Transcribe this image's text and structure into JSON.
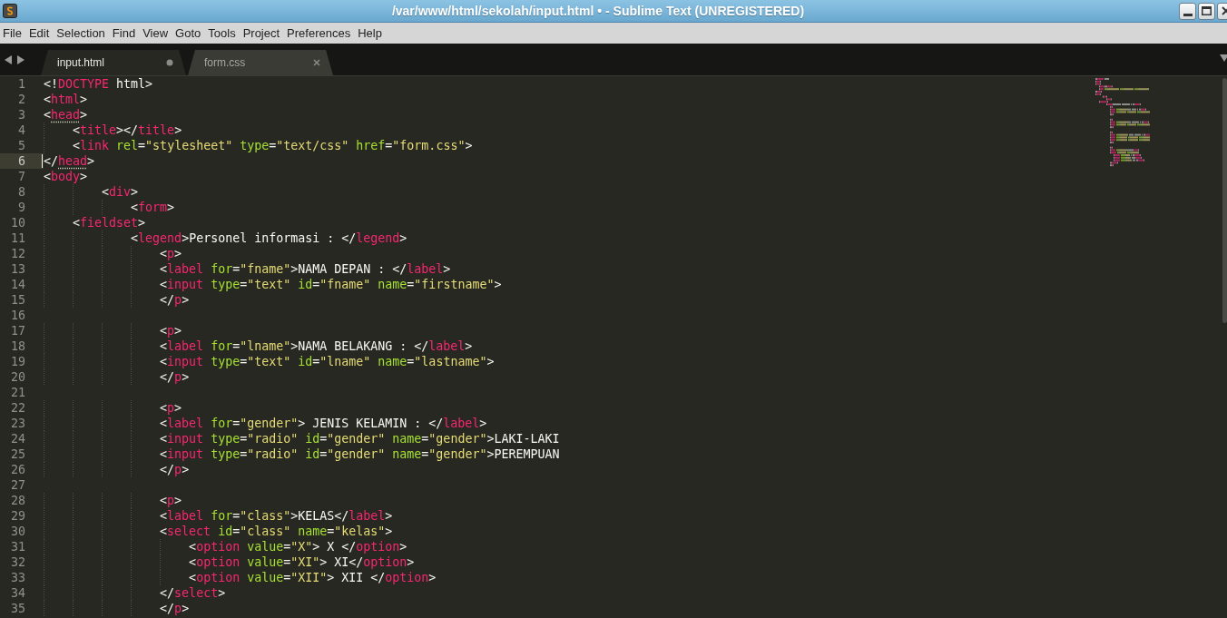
{
  "window": {
    "title": "/var/www/html/sekolah/input.html • - Sublime Text (UNREGISTERED)"
  },
  "menu": [
    "File",
    "Edit",
    "Selection",
    "Find",
    "View",
    "Goto",
    "Tools",
    "Project",
    "Preferences",
    "Help"
  ],
  "tabs": [
    {
      "label": "input.html",
      "selected": true,
      "modified": true
    },
    {
      "label": "form.css",
      "selected": false,
      "modified": false
    }
  ],
  "editor": {
    "lines": [
      {
        "n": "1",
        "current": false,
        "tokens": [
          {
            "kind": "plain",
            "text": "<!"
          },
          {
            "kind": "tag",
            "text": "DOCTYPE"
          },
          {
            "kind": "plain",
            "text": " html>"
          }
        ]
      },
      {
        "n": "2",
        "current": false,
        "tokens": [
          {
            "kind": "plain",
            "text": "<"
          },
          {
            "kind": "tag",
            "text": "html"
          },
          {
            "kind": "plain",
            "text": ">"
          }
        ]
      },
      {
        "n": "3",
        "current": false,
        "tokens": [
          {
            "kind": "plain",
            "text": "<"
          },
          {
            "kind": "matched_tag",
            "text": "head"
          },
          {
            "kind": "plain",
            "text": ">"
          }
        ]
      },
      {
        "n": "4",
        "current": false,
        "tokens": [
          {
            "kind": "plain",
            "text": "    <"
          },
          {
            "kind": "tag",
            "text": "title"
          },
          {
            "kind": "plain",
            "text": "></"
          },
          {
            "kind": "tag",
            "text": "title"
          },
          {
            "kind": "plain",
            "text": ">"
          }
        ]
      },
      {
        "n": "5",
        "current": false,
        "tokens": [
          {
            "kind": "plain",
            "text": "    <"
          },
          {
            "kind": "tag",
            "text": "link"
          },
          {
            "kind": "attr",
            "text": " rel"
          },
          {
            "kind": "plain",
            "text": "="
          },
          {
            "kind": "string",
            "text": "\"stylesheet\""
          },
          {
            "kind": "attr",
            "text": " type"
          },
          {
            "kind": "plain",
            "text": "="
          },
          {
            "kind": "string",
            "text": "\"text/css\""
          },
          {
            "kind": "attr",
            "text": " href"
          },
          {
            "kind": "plain",
            "text": "="
          },
          {
            "kind": "string",
            "text": "\"form.css\""
          },
          {
            "kind": "plain",
            "text": ">"
          }
        ]
      },
      {
        "n": "6",
        "current": true,
        "tokens": [
          {
            "kind": "plain",
            "text": "</"
          },
          {
            "kind": "matched_tag",
            "text": "head"
          },
          {
            "kind": "plain",
            "text": ">"
          }
        ]
      },
      {
        "n": "7",
        "current": false,
        "tokens": [
          {
            "kind": "plain",
            "text": "<"
          },
          {
            "kind": "tag",
            "text": "body"
          },
          {
            "kind": "plain",
            "text": ">"
          }
        ]
      },
      {
        "n": "8",
        "current": false,
        "tokens": [
          {
            "kind": "plain",
            "text": "        <"
          },
          {
            "kind": "tag",
            "text": "div"
          },
          {
            "kind": "plain",
            "text": ">"
          }
        ]
      },
      {
        "n": "9",
        "current": false,
        "tokens": [
          {
            "kind": "plain",
            "text": "            <"
          },
          {
            "kind": "tag",
            "text": "form"
          },
          {
            "kind": "plain",
            "text": ">"
          }
        ]
      },
      {
        "n": "10",
        "current": false,
        "tokens": [
          {
            "kind": "plain",
            "text": "    <"
          },
          {
            "kind": "tag",
            "text": "fieldset"
          },
          {
            "kind": "plain",
            "text": ">"
          }
        ]
      },
      {
        "n": "11",
        "current": false,
        "tokens": [
          {
            "kind": "plain",
            "text": "            <"
          },
          {
            "kind": "tag",
            "text": "legend"
          },
          {
            "kind": "plain",
            "text": ">Personel informasi : </"
          },
          {
            "kind": "tag",
            "text": "legend"
          },
          {
            "kind": "plain",
            "text": ">"
          }
        ]
      },
      {
        "n": "12",
        "current": false,
        "tokens": [
          {
            "kind": "plain",
            "text": "                <"
          },
          {
            "kind": "tag",
            "text": "p"
          },
          {
            "kind": "plain",
            "text": ">"
          }
        ]
      },
      {
        "n": "13",
        "current": false,
        "tokens": [
          {
            "kind": "plain",
            "text": "                <"
          },
          {
            "kind": "tag",
            "text": "label"
          },
          {
            "kind": "attr",
            "text": " for"
          },
          {
            "kind": "plain",
            "text": "="
          },
          {
            "kind": "string",
            "text": "\"fname\""
          },
          {
            "kind": "plain",
            "text": ">NAMA DEPAN : </"
          },
          {
            "kind": "tag",
            "text": "label"
          },
          {
            "kind": "plain",
            "text": ">"
          }
        ]
      },
      {
        "n": "14",
        "current": false,
        "tokens": [
          {
            "kind": "plain",
            "text": "                <"
          },
          {
            "kind": "tag",
            "text": "input"
          },
          {
            "kind": "attr",
            "text": " type"
          },
          {
            "kind": "plain",
            "text": "="
          },
          {
            "kind": "string",
            "text": "\"text\""
          },
          {
            "kind": "attr",
            "text": " id"
          },
          {
            "kind": "plain",
            "text": "="
          },
          {
            "kind": "string",
            "text": "\"fname\""
          },
          {
            "kind": "attr",
            "text": " name"
          },
          {
            "kind": "plain",
            "text": "="
          },
          {
            "kind": "string",
            "text": "\"firstname\""
          },
          {
            "kind": "plain",
            "text": ">"
          }
        ]
      },
      {
        "n": "15",
        "current": false,
        "tokens": [
          {
            "kind": "plain",
            "text": "                </"
          },
          {
            "kind": "tag",
            "text": "p"
          },
          {
            "kind": "plain",
            "text": ">"
          }
        ]
      },
      {
        "n": "16",
        "current": false
      },
      {
        "n": "17",
        "current": false,
        "tokens": [
          {
            "kind": "plain",
            "text": "                <"
          },
          {
            "kind": "tag",
            "text": "p"
          },
          {
            "kind": "plain",
            "text": ">"
          }
        ]
      },
      {
        "n": "18",
        "current": false,
        "tokens": [
          {
            "kind": "plain",
            "text": "                <"
          },
          {
            "kind": "tag",
            "text": "label"
          },
          {
            "kind": "attr",
            "text": " for"
          },
          {
            "kind": "plain",
            "text": "="
          },
          {
            "kind": "string",
            "text": "\"lname\""
          },
          {
            "kind": "plain",
            "text": ">NAMA BELAKANG : </"
          },
          {
            "kind": "tag",
            "text": "label"
          },
          {
            "kind": "plain",
            "text": ">"
          }
        ]
      },
      {
        "n": "19",
        "current": false,
        "tokens": [
          {
            "kind": "plain",
            "text": "                <"
          },
          {
            "kind": "tag",
            "text": "input"
          },
          {
            "kind": "attr",
            "text": " type"
          },
          {
            "kind": "plain",
            "text": "="
          },
          {
            "kind": "string",
            "text": "\"text\""
          },
          {
            "kind": "attr",
            "text": " id"
          },
          {
            "kind": "plain",
            "text": "="
          },
          {
            "kind": "string",
            "text": "\"lname\""
          },
          {
            "kind": "attr",
            "text": " name"
          },
          {
            "kind": "plain",
            "text": "="
          },
          {
            "kind": "string",
            "text": "\"lastname\""
          },
          {
            "kind": "plain",
            "text": ">"
          }
        ]
      },
      {
        "n": "20",
        "current": false,
        "tokens": [
          {
            "kind": "plain",
            "text": "                </"
          },
          {
            "kind": "tag",
            "text": "p"
          },
          {
            "kind": "plain",
            "text": ">"
          }
        ]
      },
      {
        "n": "21",
        "current": false
      },
      {
        "n": "22",
        "current": false,
        "tokens": [
          {
            "kind": "plain",
            "text": "                <"
          },
          {
            "kind": "tag",
            "text": "p"
          },
          {
            "kind": "plain",
            "text": ">"
          }
        ]
      },
      {
        "n": "23",
        "current": false,
        "tokens": [
          {
            "kind": "plain",
            "text": "                <"
          },
          {
            "kind": "tag",
            "text": "label"
          },
          {
            "kind": "attr",
            "text": " for"
          },
          {
            "kind": "plain",
            "text": "="
          },
          {
            "kind": "string",
            "text": "\"gender\""
          },
          {
            "kind": "plain",
            "text": "> JENIS KELAMIN : </"
          },
          {
            "kind": "tag",
            "text": "label"
          },
          {
            "kind": "plain",
            "text": ">"
          }
        ]
      },
      {
        "n": "24",
        "current": false,
        "tokens": [
          {
            "kind": "plain",
            "text": "                <"
          },
          {
            "kind": "tag",
            "text": "input"
          },
          {
            "kind": "attr",
            "text": " type"
          },
          {
            "kind": "plain",
            "text": "="
          },
          {
            "kind": "string",
            "text": "\"radio\""
          },
          {
            "kind": "attr",
            "text": " id"
          },
          {
            "kind": "plain",
            "text": "="
          },
          {
            "kind": "string",
            "text": "\"gender\""
          },
          {
            "kind": "attr",
            "text": " name"
          },
          {
            "kind": "plain",
            "text": "="
          },
          {
            "kind": "string",
            "text": "\"gender\""
          },
          {
            "kind": "plain",
            "text": ">LAKI-LAKI"
          }
        ]
      },
      {
        "n": "25",
        "current": false,
        "tokens": [
          {
            "kind": "plain",
            "text": "                <"
          },
          {
            "kind": "tag",
            "text": "input"
          },
          {
            "kind": "attr",
            "text": " type"
          },
          {
            "kind": "plain",
            "text": "="
          },
          {
            "kind": "string",
            "text": "\"radio\""
          },
          {
            "kind": "attr",
            "text": " id"
          },
          {
            "kind": "plain",
            "text": "="
          },
          {
            "kind": "string",
            "text": "\"gender\""
          },
          {
            "kind": "attr",
            "text": " name"
          },
          {
            "kind": "plain",
            "text": "="
          },
          {
            "kind": "string",
            "text": "\"gender\""
          },
          {
            "kind": "plain",
            "text": ">PEREMPUAN"
          }
        ]
      },
      {
        "n": "26",
        "current": false,
        "tokens": [
          {
            "kind": "plain",
            "text": "                </"
          },
          {
            "kind": "tag",
            "text": "p"
          },
          {
            "kind": "plain",
            "text": ">"
          }
        ]
      },
      {
        "n": "27",
        "current": false
      },
      {
        "n": "28",
        "current": false,
        "tokens": [
          {
            "kind": "plain",
            "text": "                <"
          },
          {
            "kind": "tag",
            "text": "p"
          },
          {
            "kind": "plain",
            "text": ">"
          }
        ]
      },
      {
        "n": "29",
        "current": false,
        "tokens": [
          {
            "kind": "plain",
            "text": "                <"
          },
          {
            "kind": "tag",
            "text": "label"
          },
          {
            "kind": "attr",
            "text": " for"
          },
          {
            "kind": "plain",
            "text": "="
          },
          {
            "kind": "string",
            "text": "\"class\""
          },
          {
            "kind": "plain",
            "text": ">KELAS</"
          },
          {
            "kind": "tag",
            "text": "label"
          },
          {
            "kind": "plain",
            "text": ">"
          }
        ]
      },
      {
        "n": "30",
        "current": false,
        "tokens": [
          {
            "kind": "plain",
            "text": "                <"
          },
          {
            "kind": "tag",
            "text": "select"
          },
          {
            "kind": "attr",
            "text": " id"
          },
          {
            "kind": "plain",
            "text": "="
          },
          {
            "kind": "string",
            "text": "\"class\""
          },
          {
            "kind": "attr",
            "text": " name"
          },
          {
            "kind": "plain",
            "text": "="
          },
          {
            "kind": "string",
            "text": "\"kelas\""
          },
          {
            "kind": "plain",
            "text": ">"
          }
        ]
      },
      {
        "n": "31",
        "current": false,
        "tokens": [
          {
            "kind": "plain",
            "text": "                    <"
          },
          {
            "kind": "tag",
            "text": "option"
          },
          {
            "kind": "attr",
            "text": " value"
          },
          {
            "kind": "plain",
            "text": "="
          },
          {
            "kind": "string",
            "text": "\"X\""
          },
          {
            "kind": "plain",
            "text": "> X </"
          },
          {
            "kind": "tag",
            "text": "option"
          },
          {
            "kind": "plain",
            "text": ">"
          }
        ]
      },
      {
        "n": "32",
        "current": false,
        "tokens": [
          {
            "kind": "plain",
            "text": "                    <"
          },
          {
            "kind": "tag",
            "text": "option"
          },
          {
            "kind": "attr",
            "text": " value"
          },
          {
            "kind": "plain",
            "text": "="
          },
          {
            "kind": "string",
            "text": "\"XI\""
          },
          {
            "kind": "plain",
            "text": "> XI</"
          },
          {
            "kind": "tag",
            "text": "option"
          },
          {
            "kind": "plain",
            "text": ">"
          }
        ]
      },
      {
        "n": "33",
        "current": false,
        "tokens": [
          {
            "kind": "plain",
            "text": "                    <"
          },
          {
            "kind": "tag",
            "text": "option"
          },
          {
            "kind": "attr",
            "text": " value"
          },
          {
            "kind": "plain",
            "text": "="
          },
          {
            "kind": "string",
            "text": "\"XII\""
          },
          {
            "kind": "plain",
            "text": "> XII </"
          },
          {
            "kind": "tag",
            "text": "option"
          },
          {
            "kind": "plain",
            "text": ">"
          }
        ]
      },
      {
        "n": "34",
        "current": false,
        "tokens": [
          {
            "kind": "plain",
            "text": "                </"
          },
          {
            "kind": "tag",
            "text": "select"
          },
          {
            "kind": "plain",
            "text": ">"
          }
        ]
      },
      {
        "n": "35",
        "current": false,
        "tokens": [
          {
            "kind": "plain",
            "text": "                </"
          },
          {
            "kind": "tag",
            "text": "p"
          },
          {
            "kind": "plain",
            "text": ">"
          }
        ]
      }
    ]
  }
}
